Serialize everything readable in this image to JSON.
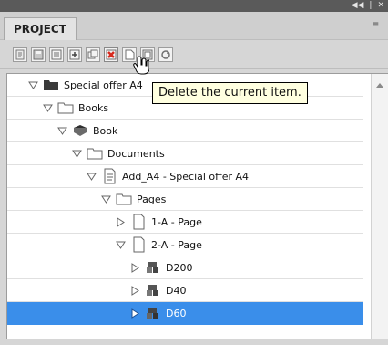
{
  "panel": {
    "tab_label": "PROJECT",
    "top_controls": [
      "◀◀",
      "|",
      "✕"
    ],
    "menu_icon": "≡"
  },
  "toolbar": {
    "buttons": [
      {
        "icon": "select-icon"
      },
      {
        "icon": "save-icon"
      },
      {
        "icon": "properties-icon"
      },
      {
        "icon": "add-icon"
      },
      {
        "icon": "duplicate-icon"
      },
      {
        "icon": "delete-icon"
      },
      {
        "icon": "new-page-icon"
      },
      {
        "icon": "frame-icon"
      },
      {
        "icon": "refresh-icon"
      }
    ],
    "tooltip": "Delete the current item."
  },
  "tree": {
    "items": [
      {
        "label": "Special offer A4",
        "icon": "project-folder-icon",
        "state": "expanded"
      },
      {
        "label": "Books",
        "icon": "folder-icon",
        "state": "expanded"
      },
      {
        "label": "Book",
        "icon": "book-icon",
        "state": "expanded"
      },
      {
        "label": "Documents",
        "icon": "folder-icon",
        "state": "expanded"
      },
      {
        "label": "Add_A4 - Special offer A4",
        "icon": "document-icon",
        "state": "expanded"
      },
      {
        "label": "Pages",
        "icon": "folder-icon",
        "state": "expanded"
      },
      {
        "label": "1-A - Page",
        "icon": "page-icon",
        "state": "collapsed"
      },
      {
        "label": "2-A - Page",
        "icon": "page-icon",
        "state": "expanded"
      },
      {
        "label": "D200",
        "icon": "component-icon",
        "state": "collapsed"
      },
      {
        "label": "D40",
        "icon": "component-icon",
        "state": "collapsed"
      },
      {
        "label": "D60",
        "icon": "component-icon",
        "state": "collapsed",
        "selected": true
      }
    ]
  },
  "colors": {
    "selection": "#3a8eea",
    "delete_red": "#d62a1e"
  }
}
